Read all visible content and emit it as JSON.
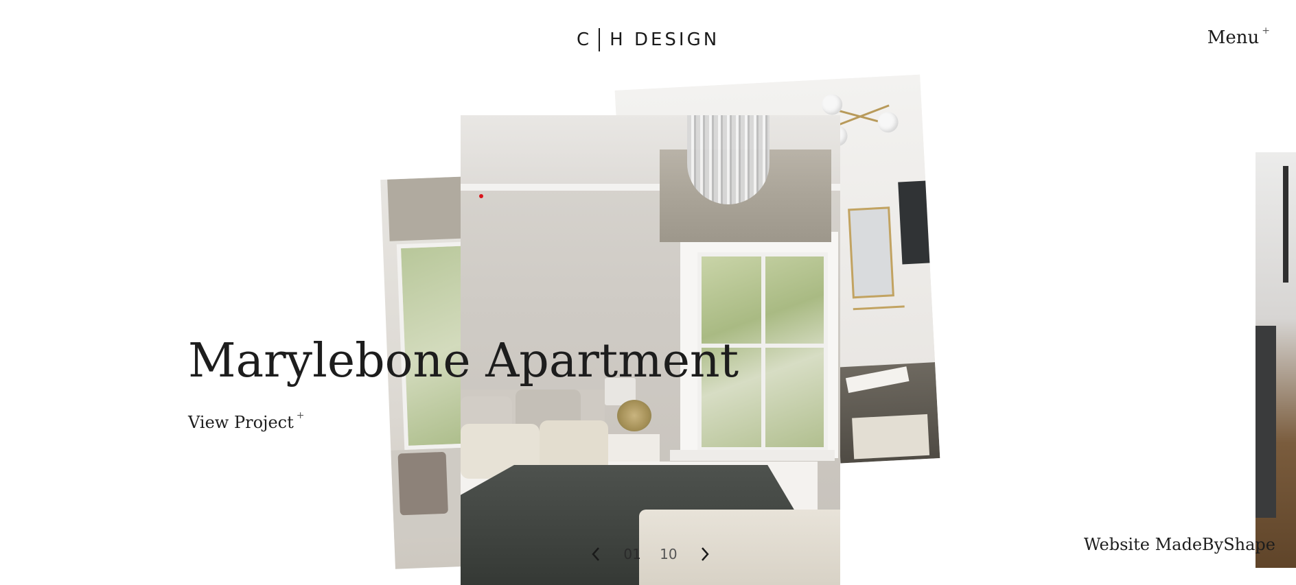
{
  "header": {
    "logo_left": "C",
    "logo_right": "H DESIGN",
    "menu_label": "Menu",
    "menu_suffix": "+"
  },
  "hero": {
    "title": "Marylebone Apartment",
    "cta_label": "View Project",
    "cta_suffix": "+"
  },
  "pagination": {
    "current": "01",
    "total": "10",
    "prev_icon": "chevron-left-icon",
    "next_icon": "chevron-right-icon"
  },
  "footer": {
    "credit": "Website MadeByShape"
  },
  "colors": {
    "text": "#1d1d1d",
    "accent_dot": "#d9141b",
    "background": "#ffffff"
  }
}
